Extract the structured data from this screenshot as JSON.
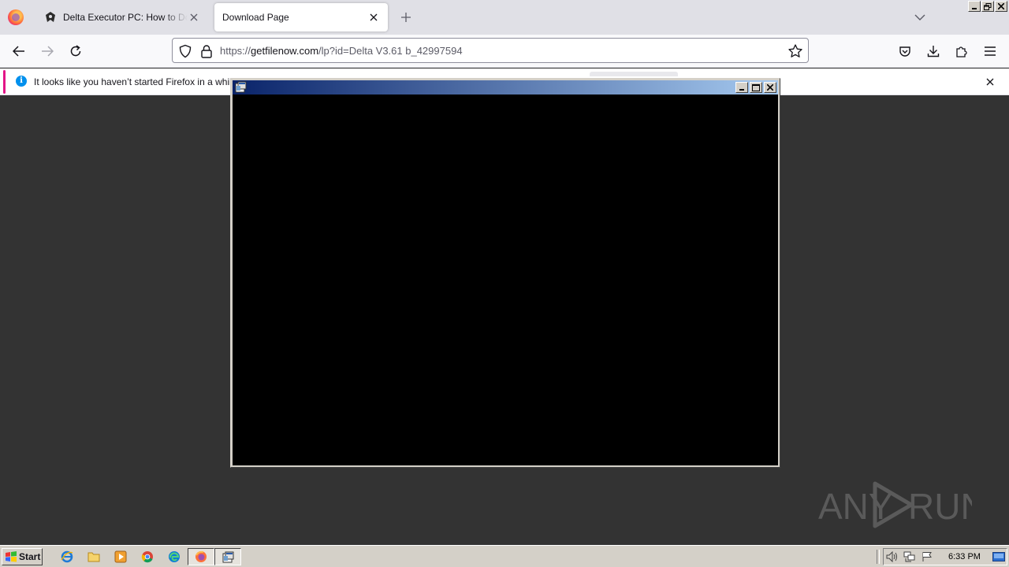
{
  "browser": {
    "tabs": [
      {
        "title": "Delta Executor PC: How to Download",
        "active": false
      },
      {
        "title": "Download Page",
        "active": true
      }
    ],
    "url": {
      "scheme": "https://",
      "host": "getfilenow.com",
      "path": "/lp?id=Delta V3.61 b_42997594"
    },
    "notification": {
      "message": "It looks like you haven’t started Firefox in a while. D"
    }
  },
  "console_window": {
    "title": ""
  },
  "watermark": {
    "left_text": "ANY",
    "right_text": "RUN"
  },
  "taskbar": {
    "start_label": "Start",
    "clock": "6:33 PM",
    "quick_launch": [
      "internet-explorer-icon",
      "folder-icon",
      "media-player-icon",
      "chrome-icon",
      "edge-icon",
      "firefox-icon",
      "console-app-icon"
    ]
  },
  "colors": {
    "page_background": "#333333",
    "titlebar_gradient_start": "#0a246a",
    "titlebar_gradient_end": "#a6caf0",
    "notification_accent": "#e31587",
    "info_icon": "#0090ed"
  }
}
